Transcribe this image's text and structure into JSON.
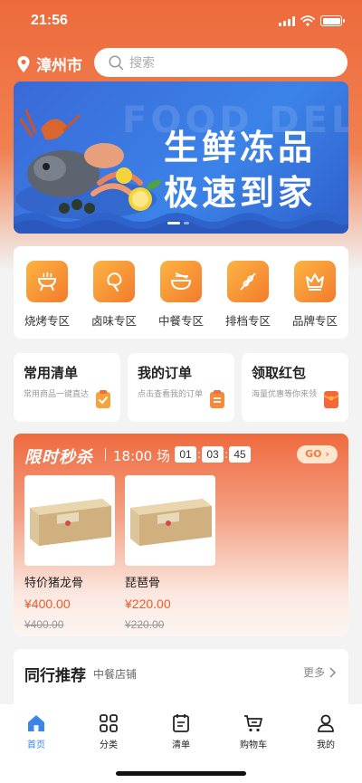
{
  "status_bar": {
    "time": "21:56"
  },
  "header": {
    "city": "漳州市",
    "search_placeholder": "搜索"
  },
  "banner": {
    "line1": "生鲜冻品",
    "line2": "极速到家",
    "watermark": "FOOD DELIVERY"
  },
  "categories": [
    {
      "label": "烧烤专区",
      "icon": "grill-icon"
    },
    {
      "label": "卤味专区",
      "icon": "drumstick-icon"
    },
    {
      "label": "中餐专区",
      "icon": "noodle-bowl-icon"
    },
    {
      "label": "排档专区",
      "icon": "skewer-icon"
    },
    {
      "label": "品牌专区",
      "icon": "crown-icon"
    }
  ],
  "quick_cards": [
    {
      "title": "常用清单",
      "desc": "常用商品一键直达",
      "icon": "checklist-icon"
    },
    {
      "title": "我的订单",
      "desc": "点击查看我的订单",
      "icon": "clipboard-icon"
    },
    {
      "title": "领取红包",
      "desc": "海量优惠等你来领",
      "icon": "red-envelope-icon"
    }
  ],
  "flash_sale": {
    "title": "限时秒杀",
    "session": "18:00 场",
    "countdown": {
      "h": "01",
      "m": "03",
      "s": "45"
    },
    "go_label": "GO",
    "products": [
      {
        "name": "特价猪龙骨",
        "price": "¥400.00",
        "old_price": "¥400.00"
      },
      {
        "name": "琵琶骨",
        "price": "¥220.00",
        "old_price": "¥220.00"
      }
    ]
  },
  "recommend": {
    "title": "同行推荐",
    "subtitle": "中餐店铺",
    "more": "更多"
  },
  "tabbar": [
    {
      "label": "首页",
      "icon": "home-icon",
      "active": true
    },
    {
      "label": "分类",
      "icon": "grid-icon",
      "active": false
    },
    {
      "label": "清单",
      "icon": "list-icon",
      "active": false
    },
    {
      "label": "购物车",
      "icon": "cart-icon",
      "active": false
    },
    {
      "label": "我的",
      "icon": "user-icon",
      "active": false
    }
  ],
  "colors": {
    "primary": "#ee6a3c",
    "accent_blue": "#3b86e8",
    "price_red": "#f05a2a"
  }
}
